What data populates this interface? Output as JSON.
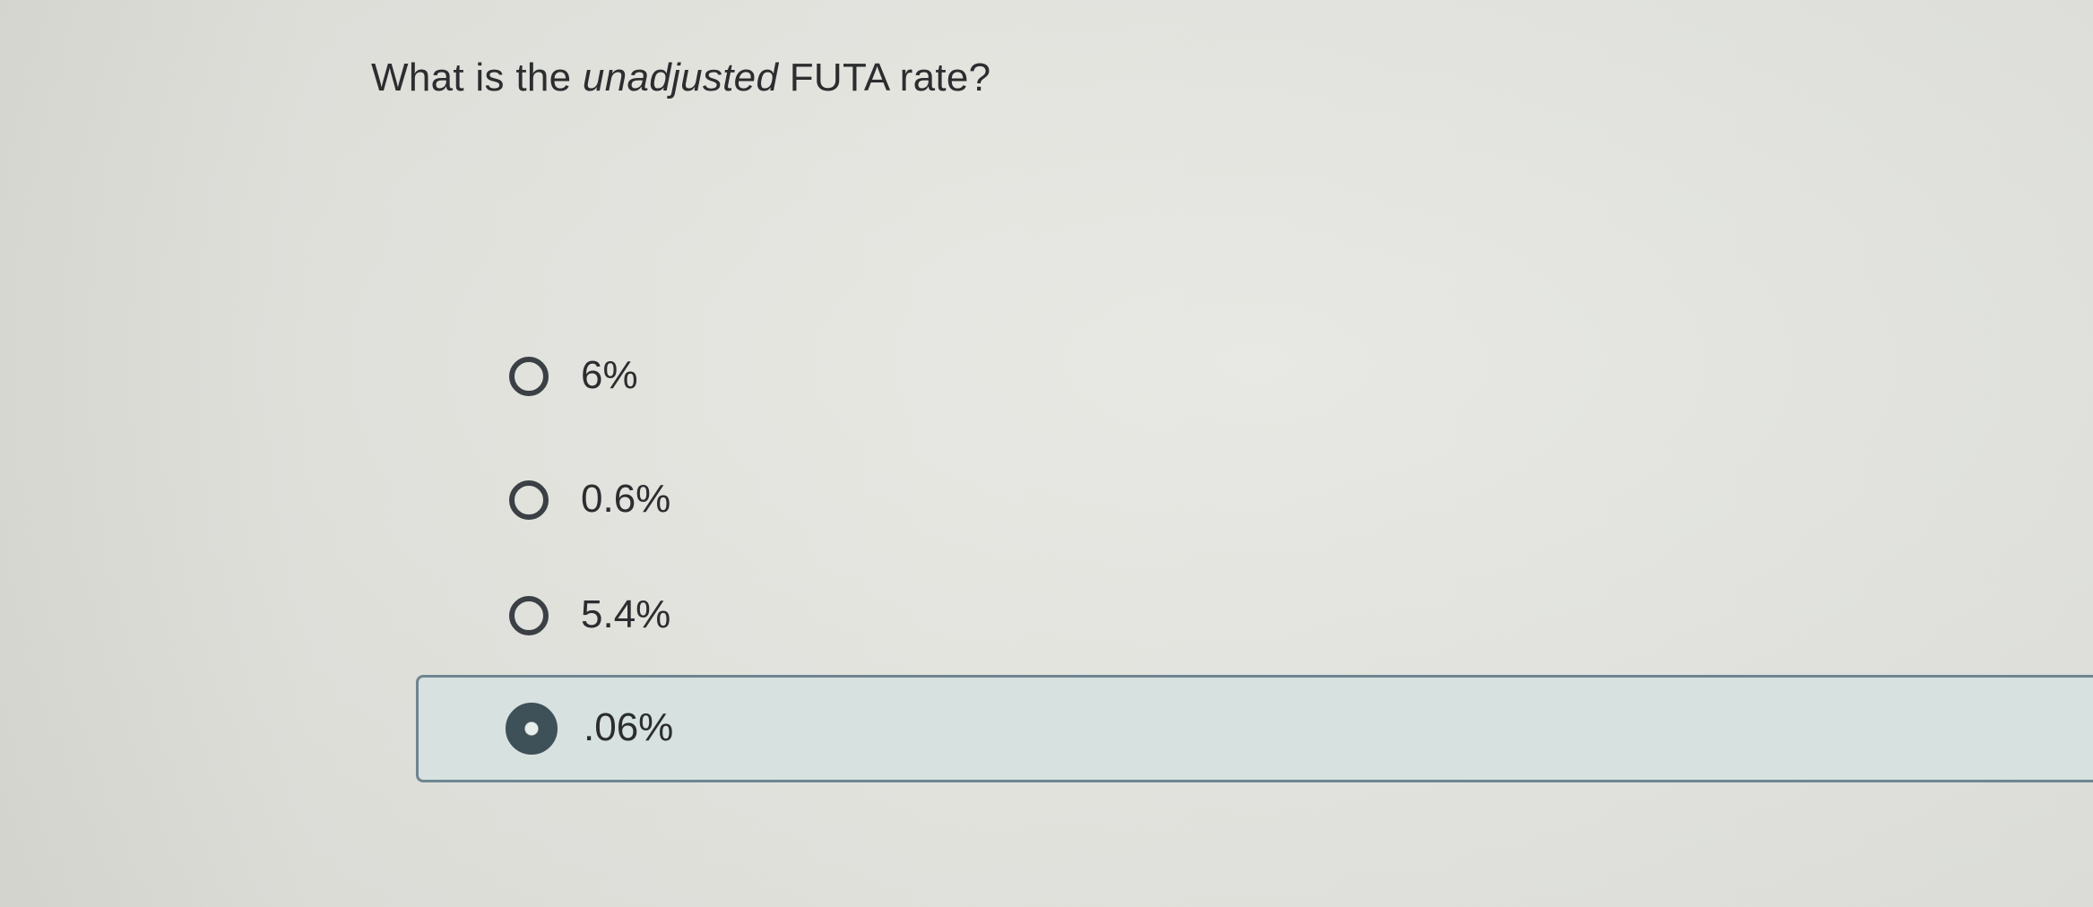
{
  "question": {
    "prefix": "What is the ",
    "emphasis": "unadjusted",
    "suffix": " FUTA rate?"
  },
  "options": [
    {
      "label": "6%",
      "selected": false
    },
    {
      "label": "0.6%",
      "selected": false
    },
    {
      "label": "5.4%",
      "selected": false
    },
    {
      "label": ".06%",
      "selected": true
    }
  ],
  "colors": {
    "selected_background": "#d7e1df",
    "selected_border": "#6f8690",
    "text": "#2b2d2f"
  }
}
